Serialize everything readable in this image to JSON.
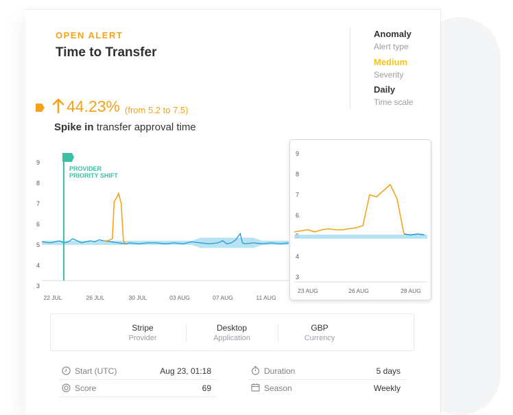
{
  "header": {
    "eyebrow": "OPEN ALERT",
    "title": "Time to Transfer"
  },
  "meta": [
    {
      "value": "Anomaly",
      "label": "Alert type",
      "color": "#333333"
    },
    {
      "value": "Medium",
      "label": "Severity",
      "color": "#f5c518"
    },
    {
      "value": "Daily",
      "label": "Time scale",
      "color": "#333333"
    }
  ],
  "metric": {
    "percent": "44.23%",
    "range": "(from 5.2 to 7.5)",
    "desc_bold": "Spike in",
    "desc_rest": " transfer approval time",
    "direction_icon": "arrow-up-icon",
    "flag_icon": "alert-flag-icon"
  },
  "chart_data": [
    {
      "type": "line",
      "x_tick_labels": [
        "22 JUL",
        "26 JUL",
        "30 JUL",
        "03 AUG",
        "07 AUG",
        "11 AUG"
      ],
      "y_tick_labels": [
        "9",
        "8",
        "7",
        "6",
        "5",
        "4",
        "3"
      ],
      "ylim": [
        3,
        9
      ],
      "annotation": "PROVIDER PRIORITY SHIFT",
      "series": [
        {
          "role": "actual",
          "color": "#1b9ad6"
        },
        {
          "role": "anomaly",
          "color": "#f5a21a"
        },
        {
          "role": "expected band",
          "color": "#a8dcef"
        },
        {
          "role": "annotation marker",
          "color": "#3cbfa5"
        }
      ],
      "points": [
        [
          0,
          5.15
        ],
        [
          2,
          5.1
        ],
        [
          4,
          5.2
        ],
        [
          5,
          5.1
        ],
        [
          6,
          5.15
        ],
        [
          7,
          5.3
        ],
        [
          8,
          5.2
        ],
        [
          9,
          5.1
        ],
        [
          10,
          5.15
        ],
        [
          11,
          5.2
        ],
        [
          12,
          5.15
        ],
        [
          13,
          5.25
        ],
        [
          14,
          5.2
        ],
        [
          15,
          5.2
        ],
        [
          16,
          5.3
        ],
        [
          16.4,
          7.1
        ],
        [
          17,
          7.3
        ],
        [
          17.4,
          7.5
        ],
        [
          18,
          7.0
        ],
        [
          18.5,
          5.2
        ],
        [
          19,
          5.05
        ],
        [
          20,
          5.1
        ],
        [
          22,
          5.05
        ],
        [
          24,
          5.1
        ],
        [
          26,
          5.1
        ],
        [
          28,
          5.05
        ],
        [
          30,
          5.1
        ],
        [
          32,
          5.05
        ],
        [
          34,
          5.15
        ],
        [
          36,
          5.1
        ],
        [
          38,
          5.05
        ],
        [
          40,
          5.1
        ],
        [
          41,
          5.2
        ],
        [
          42,
          5.05
        ],
        [
          43,
          5.1
        ],
        [
          44,
          5.25
        ],
        [
          45,
          5.55
        ],
        [
          45.5,
          5.1
        ],
        [
          46,
          5.05
        ],
        [
          48,
          5.1
        ],
        [
          50,
          5.05
        ],
        [
          52,
          5.1
        ],
        [
          54,
          5.05
        ],
        [
          56,
          5.1
        ]
      ]
    },
    {
      "type": "line",
      "x_tick_labels": [
        "23 AUG",
        "26 AUG",
        "28 AUG"
      ],
      "y_tick_labels": [
        "9",
        "8",
        "7",
        "6",
        "5",
        "4",
        "3"
      ],
      "ylim": [
        3,
        9
      ],
      "points": [
        [
          0,
          5.2
        ],
        [
          1,
          5.25
        ],
        [
          2,
          5.3
        ],
        [
          3,
          5.2
        ],
        [
          4,
          5.3
        ],
        [
          5,
          5.35
        ],
        [
          6,
          5.3
        ],
        [
          7,
          5.3
        ],
        [
          8,
          5.35
        ],
        [
          9,
          5.4
        ],
        [
          10,
          5.5
        ],
        [
          11,
          7.0
        ],
        [
          12,
          6.9
        ],
        [
          13,
          7.2
        ],
        [
          14,
          7.5
        ],
        [
          15,
          6.8
        ],
        [
          16,
          5.1
        ],
        [
          17,
          5.05
        ],
        [
          18,
          5.1
        ],
        [
          19,
          5.05
        ]
      ]
    }
  ],
  "attributes": [
    {
      "value": "Stripe",
      "label": "Provider"
    },
    {
      "value": "Desktop",
      "label": "Application"
    },
    {
      "value": "GBP",
      "label": "Currency"
    }
  ],
  "stats_left": [
    {
      "label": "Start (UTC)",
      "value": "Aug 23, 01:18",
      "icon": "clock-icon"
    },
    {
      "label": "Score",
      "value": "69",
      "icon": "score-gauge-icon"
    }
  ],
  "stats_right": [
    {
      "label": "Duration",
      "value": "5 days",
      "icon": "stopwatch-icon"
    },
    {
      "label": "Season",
      "value": "Weekly",
      "icon": "calendar-icon"
    }
  ]
}
